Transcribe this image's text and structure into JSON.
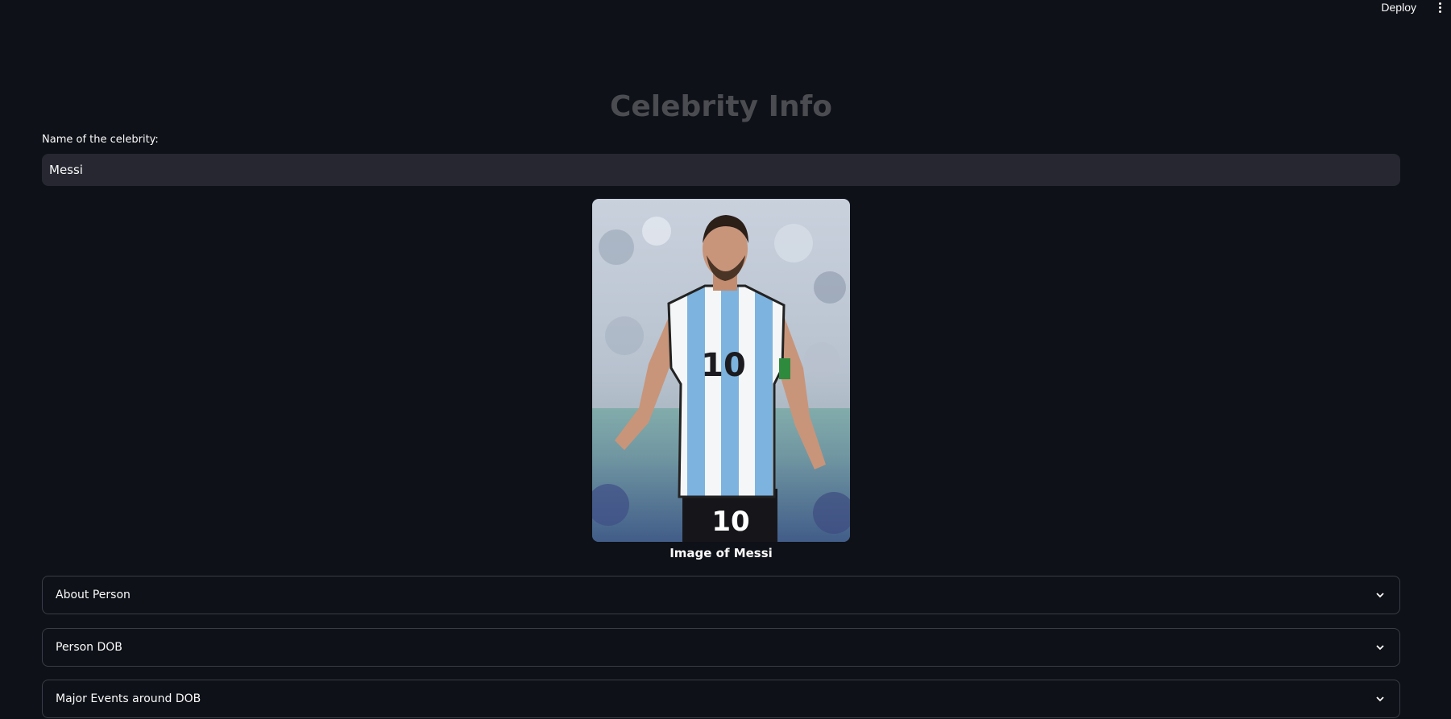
{
  "header": {
    "deploy_label": "Deploy",
    "menu_icon": "kebab-menu-icon"
  },
  "main": {
    "title": "Celebrity Info",
    "name_field": {
      "label": "Name of the celebrity:",
      "value": "Messi"
    },
    "image": {
      "caption": "Image of Messi"
    },
    "expanders": [
      {
        "label": "About Person",
        "icon": "chevron-down-icon"
      },
      {
        "label": "Person DOB",
        "icon": "chevron-down-icon"
      },
      {
        "label": "Major Events around DOB",
        "icon": "chevron-down-icon"
      }
    ]
  },
  "colors": {
    "background": "#0e1117",
    "input_bg": "#262730",
    "title": "#4a4c52",
    "text": "#fafafa",
    "border": "#3a3d46"
  }
}
